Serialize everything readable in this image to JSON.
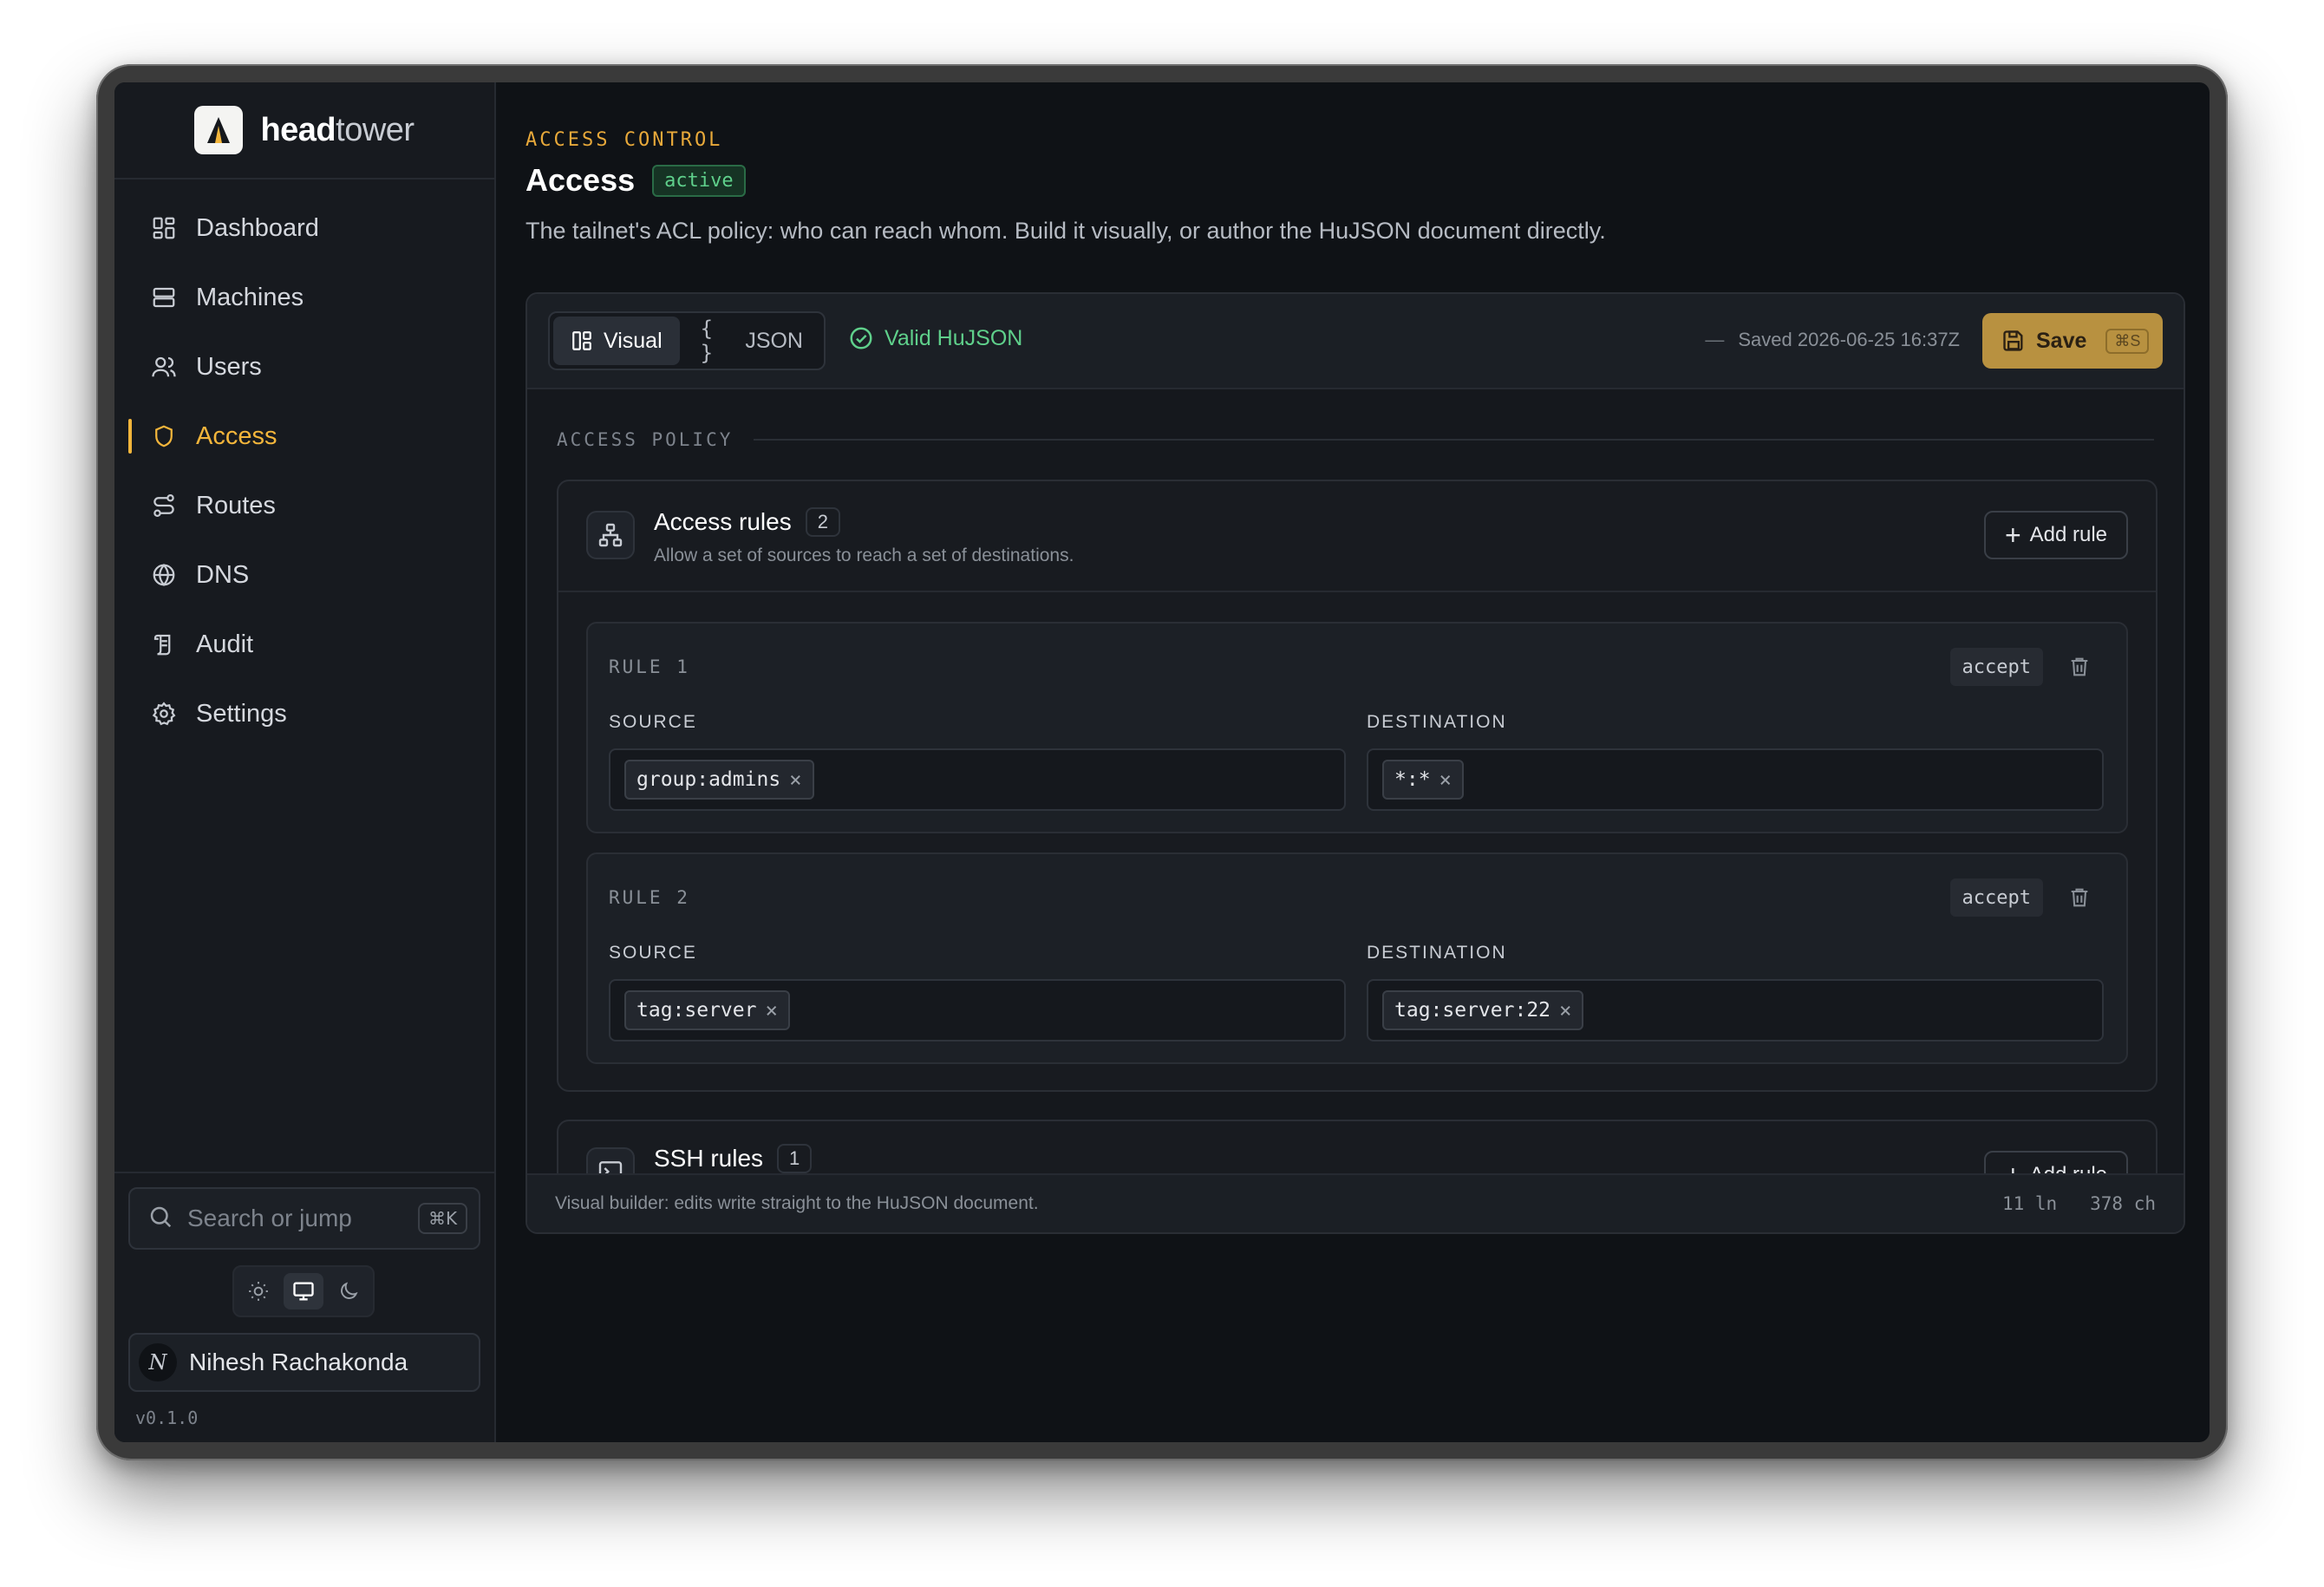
{
  "brand": {
    "name_bold": "head",
    "name_light": "tower"
  },
  "nav": [
    {
      "label": "Dashboard",
      "icon": "dashboard-icon"
    },
    {
      "label": "Machines",
      "icon": "server-icon"
    },
    {
      "label": "Users",
      "icon": "users-icon"
    },
    {
      "label": "Access",
      "icon": "shield-icon"
    },
    {
      "label": "Routes",
      "icon": "routes-icon"
    },
    {
      "label": "DNS",
      "icon": "globe-icon"
    },
    {
      "label": "Audit",
      "icon": "scroll-icon"
    },
    {
      "label": "Settings",
      "icon": "gear-icon"
    }
  ],
  "sidebar_bottom": {
    "search_placeholder": "Search or jump",
    "search_kbd": "⌘K",
    "user_name": "Nihesh Rachakonda",
    "avatar_initials": "N",
    "version": "v0.1.0"
  },
  "page": {
    "eyebrow": "ACCESS CONTROL",
    "title": "Access",
    "status": "active",
    "description": "The tailnet's ACL policy: who can reach whom. Build it visually, or author the HuJSON document directly."
  },
  "toolbar": {
    "tab_visual": "Visual",
    "tab_json": "JSON",
    "valid_text": "Valid HuJSON",
    "saved_text": "Saved 2026-06-25 16:37Z",
    "save_label": "Save",
    "save_kbd": "⌘S"
  },
  "section_label": "ACCESS POLICY",
  "access_rules": {
    "title": "Access rules",
    "count": "2",
    "subtitle": "Allow a set of sources to reach a set of destinations.",
    "add_label": "Add rule",
    "source_label": "SOURCE",
    "destination_label": "DESTINATION",
    "rules": [
      {
        "label": "RULE 1",
        "action": "accept",
        "source": "group:admins",
        "destination": "*:*"
      },
      {
        "label": "RULE 2",
        "action": "accept",
        "source": "tag:server",
        "destination": "tag:server:22"
      }
    ]
  },
  "ssh_rules": {
    "title": "SSH rules",
    "count": "1",
    "add_label": "Add rule"
  },
  "footer": {
    "note": "Visual builder: edits write straight to the HuJSON document.",
    "lines": "11 ln",
    "chars": "378 ch"
  },
  "colors": {
    "accent": "#f2b53b",
    "success": "#5fd08b",
    "save": "#b89140",
    "background": "#0f1216"
  }
}
